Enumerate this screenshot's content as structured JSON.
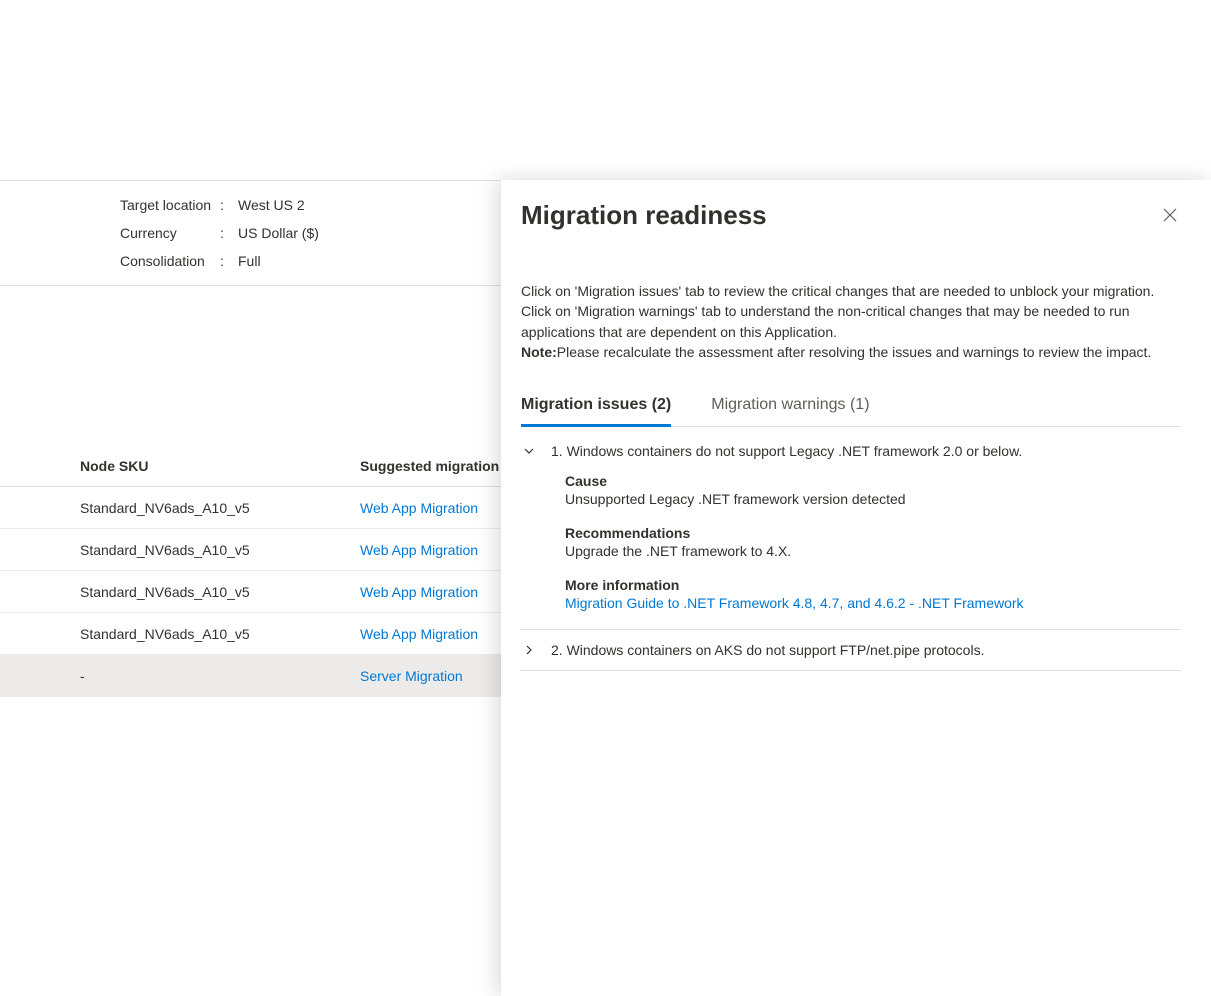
{
  "properties": {
    "target_location_label": "Target location",
    "target_location_value": "West US 2",
    "currency_label": "Currency",
    "currency_value": "US Dollar ($)",
    "consolidation_label": "Consolidation",
    "consolidation_value": "Full"
  },
  "table": {
    "header_sku": "Node SKU",
    "header_mig": "Suggested migration",
    "rows": [
      {
        "sku": "Standard_NV6ads_A10_v5",
        "mig": "Web App Migration"
      },
      {
        "sku": "Standard_NV6ads_A10_v5",
        "mig": "Web App Migration"
      },
      {
        "sku": "Standard_NV6ads_A10_v5",
        "mig": "Web App Migration"
      },
      {
        "sku": "Standard_NV6ads_A10_v5",
        "mig": "Web App Migration"
      },
      {
        "sku": "-",
        "mig": "Server Migration"
      }
    ]
  },
  "panel": {
    "title": "Migration readiness",
    "description_1": "Click on 'Migration issues' tab to review the critical changes that are needed to unblock your migration. Click on 'Migration warnings' tab to understand the non-critical changes that may be needed to run applications that are dependent on this Application.",
    "note_label": "Note:",
    "note_text": "Please recalculate the assessment after resolving the issues and warnings to review the impact.",
    "tabs": {
      "issues": "Migration issues (2)",
      "warnings": "Migration warnings (1)"
    },
    "issues": [
      {
        "title": "1. Windows containers do not support Legacy .NET framework 2.0 or below.",
        "expanded": true,
        "cause_label": "Cause",
        "cause_text": "Unsupported Legacy .NET framework version detected",
        "rec_label": "Recommendations",
        "rec_text": "Upgrade the .NET framework to 4.X.",
        "more_label": "More information",
        "more_link": "Migration Guide to .NET Framework 4.8, 4.7, and 4.6.2 - .NET Framework"
      },
      {
        "title": "2. Windows containers on AKS do not support FTP/net.pipe protocols.",
        "expanded": false
      }
    ]
  }
}
